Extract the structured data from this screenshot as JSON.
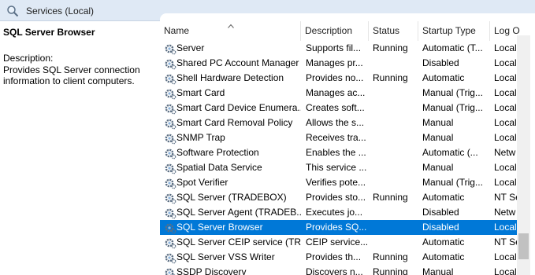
{
  "window": {
    "title": "Services (Local)"
  },
  "left_pane": {
    "service_name": "SQL Server Browser",
    "description_label": "Description:",
    "description_text": "Provides SQL Server connection information to client computers."
  },
  "columns": [
    "Name",
    "Description",
    "Status",
    "Startup Type",
    "Log O"
  ],
  "rows": [
    {
      "name": "Server",
      "description": "Supports fil...",
      "status": "Running",
      "startup": "Automatic (T...",
      "logon": "Local"
    },
    {
      "name": "Shared PC Account Manager",
      "description": "Manages pr...",
      "status": "",
      "startup": "Disabled",
      "logon": "Local"
    },
    {
      "name": "Shell Hardware Detection",
      "description": "Provides no...",
      "status": "Running",
      "startup": "Automatic",
      "logon": "Local"
    },
    {
      "name": "Smart Card",
      "description": "Manages ac...",
      "status": "",
      "startup": "Manual (Trig...",
      "logon": "Local"
    },
    {
      "name": "Smart Card Device Enumera...",
      "description": "Creates soft...",
      "status": "",
      "startup": "Manual (Trig...",
      "logon": "Local"
    },
    {
      "name": "Smart Card Removal Policy",
      "description": "Allows the s...",
      "status": "",
      "startup": "Manual",
      "logon": "Local"
    },
    {
      "name": "SNMP Trap",
      "description": "Receives tra...",
      "status": "",
      "startup": "Manual",
      "logon": "Local"
    },
    {
      "name": "Software Protection",
      "description": "Enables the ...",
      "status": "",
      "startup": "Automatic (...",
      "logon": "Netw"
    },
    {
      "name": "Spatial Data Service",
      "description": "This service ...",
      "status": "",
      "startup": "Manual",
      "logon": "Local"
    },
    {
      "name": "Spot Verifier",
      "description": "Verifies pote...",
      "status": "",
      "startup": "Manual (Trig...",
      "logon": "Local"
    },
    {
      "name": "SQL Server (TRADEBOX)",
      "description": "Provides sto...",
      "status": "Running",
      "startup": "Automatic",
      "logon": "NT Se"
    },
    {
      "name": "SQL Server Agent (TRADEB...",
      "description": "Executes jo...",
      "status": "",
      "startup": "Disabled",
      "logon": "Netw"
    },
    {
      "name": "SQL Server Browser",
      "description": "Provides SQ...",
      "status": "",
      "startup": "Disabled",
      "logon": "Local",
      "selected": true
    },
    {
      "name": "SQL Server CEIP service (TR...",
      "description": "CEIP service...",
      "status": "",
      "startup": "Automatic",
      "logon": "NT Se"
    },
    {
      "name": "SQL Server VSS Writer",
      "description": "Provides th...",
      "status": "Running",
      "startup": "Automatic",
      "logon": "Local"
    },
    {
      "name": "SSDP Discovery",
      "description": "Discovers n...",
      "status": "Running",
      "startup": "Manual",
      "logon": "Local"
    }
  ],
  "icons": {
    "title": "search-icon",
    "service": "gear-icon",
    "sort": "sort-up-arrow-icon"
  },
  "colors": {
    "selection": "#0078d7",
    "titlebar": "#dfe9f5"
  }
}
